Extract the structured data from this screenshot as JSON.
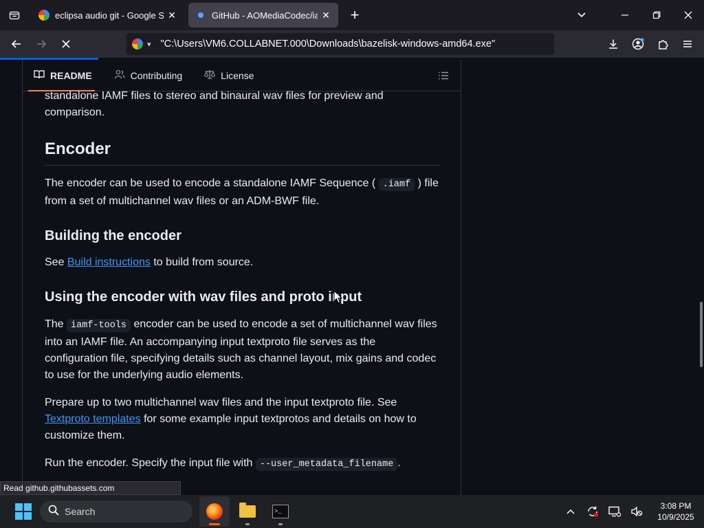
{
  "browser": {
    "tabs": [
      {
        "title": "eclipsa audio git - Google Search",
        "active": false,
        "favicon": "google-icon"
      },
      {
        "title": "GitHub - AOMediaCodec/iamf-tools",
        "active": true,
        "favicon": "github-icon"
      }
    ],
    "new_tab_glyph": "+",
    "url": "\"C:\\Users\\VM6.COLLABNET.000\\Downloads\\bazelisk-windows-amd64.exe\"",
    "load_progress": 0.14,
    "status_text": "Read github.githubassets.com"
  },
  "readme_nav": {
    "items": [
      {
        "label": "README",
        "icon": "book-icon",
        "active": true
      },
      {
        "label": "Contributing",
        "icon": "people-icon",
        "active": false
      },
      {
        "label": "License",
        "icon": "law-icon",
        "active": false
      }
    ]
  },
  "article": {
    "intro": "standalone IAMF files to stereo and binaural wav files for preview and comparison.",
    "h_encoder": "Encoder",
    "p_encoder_1": "The encoder can be used to encode a standalone IAMF Sequence (",
    "p_encoder_code": ".iamf",
    "p_encoder_2": ") file from a set of multichannel wav files or an ADM-BWF file.",
    "h_building": "Building the encoder",
    "p_build_1": "See ",
    "p_build_link": "Build instructions",
    "p_build_2": " to build from source.",
    "h_using": "Using the encoder with wav files and proto input",
    "p_using_1": "The ",
    "p_using_code": "iamf-tools",
    "p_using_2": " encoder can be used to encode a set of multichannel wav files into an IAMF file. An accompanying input textproto file serves as the configuration file, specifying details such as channel layout, mix gains and codec to use for the underlying audio elements.",
    "p_prepare_1": "Prepare up to two multichannel wav files and the input textproto file. See ",
    "p_prepare_link": "Textproto templates",
    "p_prepare_2": " for some example input textprotos and details on how to customize them.",
    "p_run_1": "Run the encoder. Specify the input file with ",
    "p_run_code": "--user_metadata_filename",
    "p_run_2": "."
  },
  "taskbar": {
    "search_label": "Search",
    "apps": [
      "firefox-icon",
      "file-explorer-icon",
      "terminal-icon"
    ],
    "time": "3:08 PM",
    "date": "10/9/2025"
  },
  "colors": {
    "link": "#4493f8",
    "accent_underline": "#f78166",
    "progress": "#0060df"
  }
}
